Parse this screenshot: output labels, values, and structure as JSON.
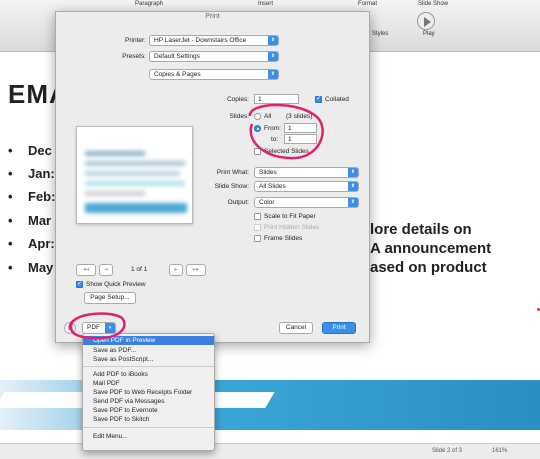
{
  "ribbon": {
    "tabs": [
      "Paragraph",
      "Insert",
      "Format",
      "Slide Show"
    ],
    "buttons": [
      "Styles",
      "Play"
    ]
  },
  "slide": {
    "title": "EMA",
    "bullets": [
      "Dec",
      "Jan:",
      "Feb:",
      "Mar",
      "Apr:",
      "May"
    ],
    "right_lines": [
      "lore details on",
      "A announcement",
      "ased on product"
    ]
  },
  "status": {
    "slide_label": "Slide 2 of 3",
    "zoom": "161%"
  },
  "print": {
    "title": "Print",
    "printer_label": "Printer:",
    "printer_value": "HP LaserJet - Downstairs Office",
    "presets_label": "Presets:",
    "presets_value": "Default Settings",
    "section_value": "Copies & Pages",
    "copies_label": "Copies:",
    "copies_value": "1",
    "collated_label": "Collated",
    "slides_label": "Slides:",
    "all_label": "All",
    "all_count": "(3 slides)",
    "from_label": "From:",
    "from_value": "1",
    "to_label": "to:",
    "to_value": "1",
    "selected_slides_label": "Selected Slides",
    "print_what_label": "Print What:",
    "print_what_value": "Slides",
    "slide_show_label": "Slide Show:",
    "slide_show_value": "All Slides",
    "output_label": "Output:",
    "output_value": "Color",
    "scale_label": "Scale to Fit Paper",
    "hidden_label": "Print Hidden Slides",
    "frame_label": "Frame Slides",
    "page_indicator": "1 of 1",
    "nav_first": "◂◂",
    "nav_prev": "◂",
    "nav_next": "▸",
    "nav_last": "▸▸",
    "quick_preview_label": "Show Quick Preview",
    "page_setup_label": "Page Setup...",
    "help_label": "?",
    "pdf_label": "PDF",
    "cancel_label": "Cancel",
    "print_label": "Print"
  },
  "pdf_menu": {
    "items": [
      "Open PDF in Preview",
      "Save as PDF...",
      "Save as PostScript...",
      "Add PDF to iBooks",
      "Mail PDF",
      "Save PDF to Web Receipts Folder",
      "Send PDF via Messages",
      "Save PDF to Evernote",
      "Save PDF to Skitch",
      "Edit Menu..."
    ]
  },
  "colors": {
    "accent": "#3d8ee8",
    "annotation": "#e0226e",
    "banner": "#3aa6d8"
  }
}
